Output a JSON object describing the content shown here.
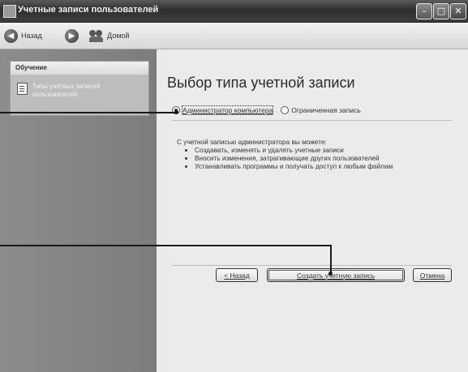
{
  "window": {
    "title": "Учетные записи пользователей"
  },
  "toolbar": {
    "back_label": "Назад",
    "home_label": "Домой"
  },
  "sidebar": {
    "panel_title": "Обучение",
    "links": [
      {
        "label": "Типы учетных записей пользователей",
        "icon": "document-icon"
      }
    ]
  },
  "main": {
    "title": "Выбор типа учетной записи",
    "radio_options": [
      {
        "label": "Администратор компьютера",
        "selected": true
      },
      {
        "label": "Ограниченная запись",
        "selected": false
      }
    ],
    "description": {
      "intro": "С учетной записью администратора вы можете:",
      "bullets": [
        "Создавать, изменять и удалять учетные записи",
        "Вносить изменения, затрагивающие других пользователей",
        "Устанавливать программы и получать доступ к любым файлам"
      ]
    },
    "buttons": {
      "back": "< Назад",
      "create": "Создать учетную запись",
      "cancel": "Отмена"
    }
  }
}
